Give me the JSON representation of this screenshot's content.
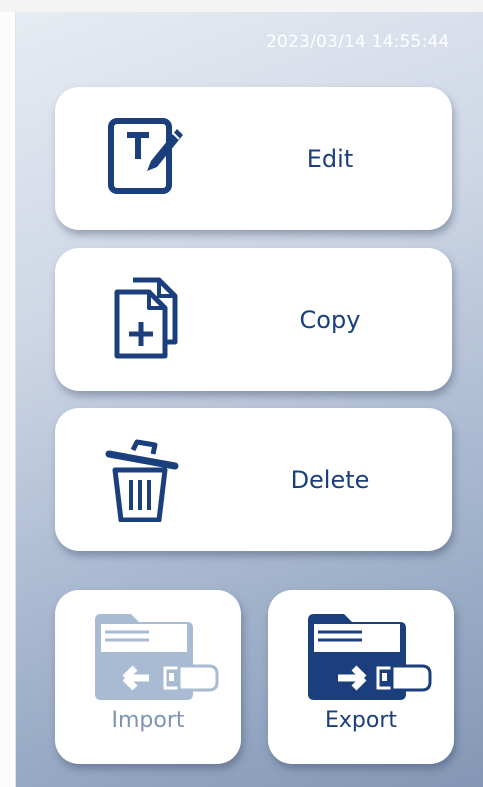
{
  "status": {
    "timestamp": "2023/03/14 14:55:44"
  },
  "actions": {
    "edit_label": "Edit",
    "copy_label": "Copy",
    "delete_label": "Delete",
    "import_label": "Import",
    "export_label": "Export"
  },
  "icons": {
    "edit": "edit-text-icon",
    "copy": "copy-add-icon",
    "delete": "trash-icon",
    "import": "folder-usb-import-icon",
    "export": "folder-usb-export-icon"
  },
  "colors": {
    "primary": "#1b3f7c",
    "disabled": "#a9bad3",
    "disabled_text": "#7f93b4",
    "card_bg": "#ffffff"
  },
  "state": {
    "import_enabled": false,
    "export_enabled": true
  }
}
